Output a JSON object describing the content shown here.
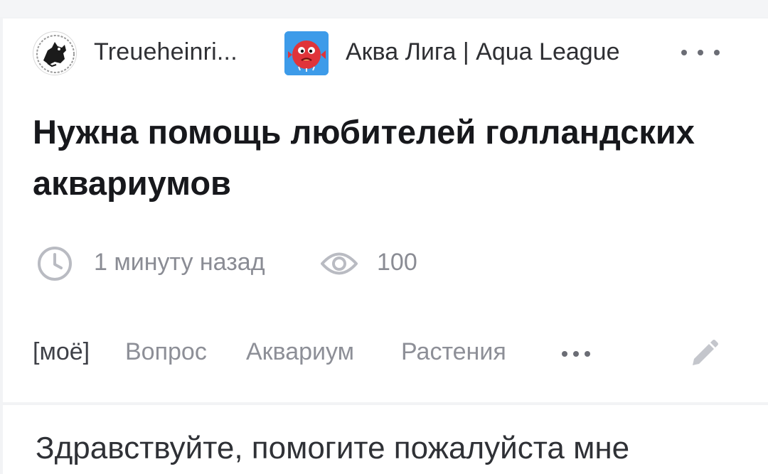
{
  "post": {
    "author": {
      "name": "Treueheinri...",
      "avatar_icon": "black-dog-emblem-avatar"
    },
    "community": {
      "name": "Аква Лига | Aqua League",
      "avatar_icon": "red-pufferfish-avatar",
      "avatar_bg": "#3d9be9"
    },
    "more_icon": "more-horizontal-icon",
    "title": "Нужна помощь любителей голландских аквариумов",
    "meta": {
      "time_icon": "clock-icon",
      "time": "1 минуту назад",
      "views_icon": "eye-icon",
      "views": "100"
    },
    "tags": {
      "mine": "[моё]",
      "items": [
        "Вопрос",
        "Аквариум",
        "Растения"
      ],
      "more_icon": "more-horizontal-icon",
      "edit_icon": "pencil-edit-icon"
    },
    "body_preview": "Здравствуйте, помогите пожалуйста мне"
  },
  "colors": {
    "background": "#f2f3f5",
    "card": "#ffffff",
    "title": "#17181c",
    "muted": "#8a8c94",
    "icon": "#6b6d75"
  }
}
